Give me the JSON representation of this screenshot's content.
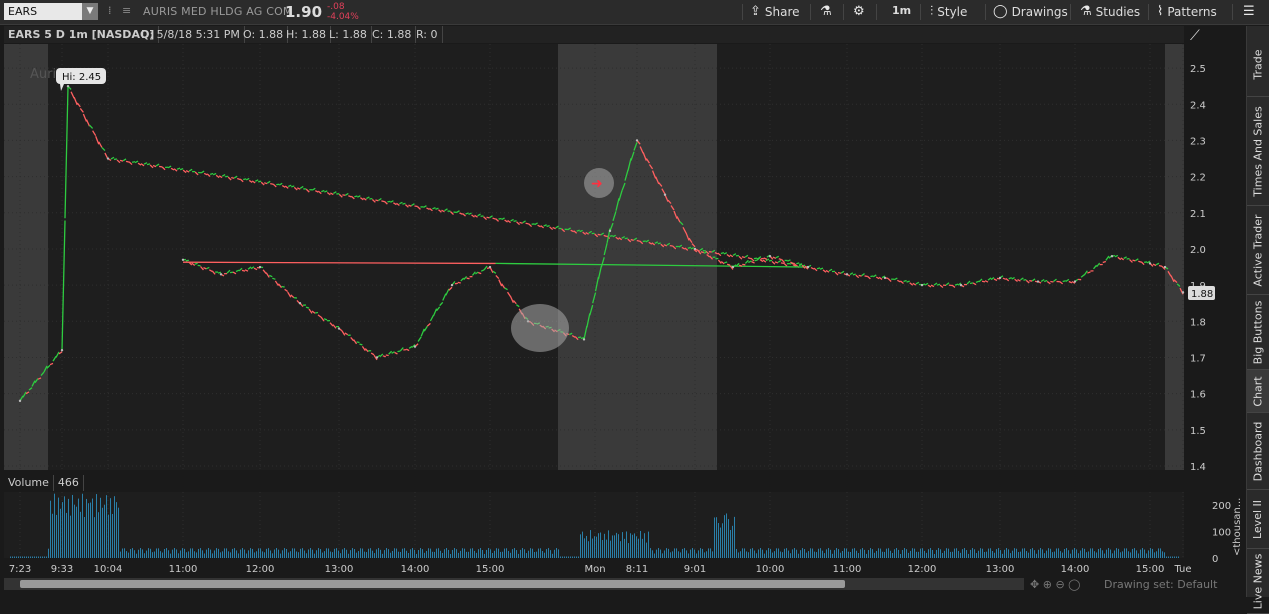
{
  "topbar": {
    "symbol": "EARS",
    "company": "AURIS MED HLDG AG COM",
    "last": "1.90",
    "change": "-.08",
    "change_pct": "-4.04%",
    "share": "Share",
    "interval": "1m",
    "style": "Style",
    "drawings": "Drawings",
    "studies": "Studies",
    "patterns": "Patterns"
  },
  "header": {
    "title": "EARS 5 D 1m [NASDAQ]",
    "date": "D: 5/8/18 5:31 PM",
    "open": "O: 1.88",
    "high": "H: 1.88",
    "low": "L: 1.88",
    "close": "C: 1.88",
    "range": "R: 0"
  },
  "hi_label": "Hi: 2.45",
  "watermark": "Auris Med",
  "last_price_label": "1.88",
  "volume_panel": {
    "label": "Volume",
    "value": "466",
    "unit": "<thousan..."
  },
  "drawing_set": "Drawing set: Default",
  "right_tabs": [
    "Trade",
    "Times And Sales",
    "Active Trader",
    "Big Buttons",
    "Chart",
    "Dashboard",
    "Level II",
    "Live News"
  ],
  "colors": {
    "up": "#2ecc40",
    "down": "#ff6060",
    "volume": "#2a7fa8",
    "shade": "#3a3a3a"
  },
  "chart_data": {
    "type": "line",
    "title": "EARS 5 D 1m [NASDAQ]",
    "ylim": [
      1.4,
      2.55
    ],
    "y_ticks": [
      2.5,
      2.4,
      2.3,
      2.2,
      2.1,
      2.0,
      1.9,
      1.8,
      1.7,
      1.6,
      1.5,
      1.4
    ],
    "x_ticks": [
      "7:23",
      "9:33",
      "10:04",
      "11:00",
      "12:00",
      "13:00",
      "14:00",
      "15:00",
      "Mon",
      "8:11",
      "9:01",
      "10:00",
      "11:00",
      "12:00",
      "13:00",
      "14:00",
      "15:00",
      "Tue"
    ],
    "volume_ticks": [
      200,
      100,
      0
    ],
    "series": [
      {
        "x": [
          "7:23",
          "9:33",
          "9:40",
          "10:04",
          "10:30",
          "11:00",
          "11:30",
          "12:00",
          "12:30",
          "13:00",
          "13:30",
          "14:00",
          "14:30",
          "15:00",
          "15:30",
          "Mon",
          "8:00",
          "8:11",
          "8:40",
          "9:01",
          "9:30",
          "10:00",
          "10:30",
          "11:00",
          "11:30",
          "12:00",
          "12:30",
          "13:00",
          "13:30",
          "14:00",
          "14:30",
          "15:00",
          "15:30",
          "Tue"
        ],
        "values": [
          1.58,
          1.72,
          2.45,
          2.25,
          1.95,
          1.97,
          1.93,
          1.95,
          1.85,
          1.78,
          1.7,
          1.73,
          1.9,
          1.95,
          1.8,
          1.75,
          2.05,
          2.3,
          2.15,
          2.0,
          1.95,
          1.98,
          1.95,
          1.93,
          1.92,
          1.9,
          1.9,
          1.92,
          1.91,
          1.91,
          1.98,
          1.96,
          1.95,
          1.88
        ]
      }
    ]
  }
}
